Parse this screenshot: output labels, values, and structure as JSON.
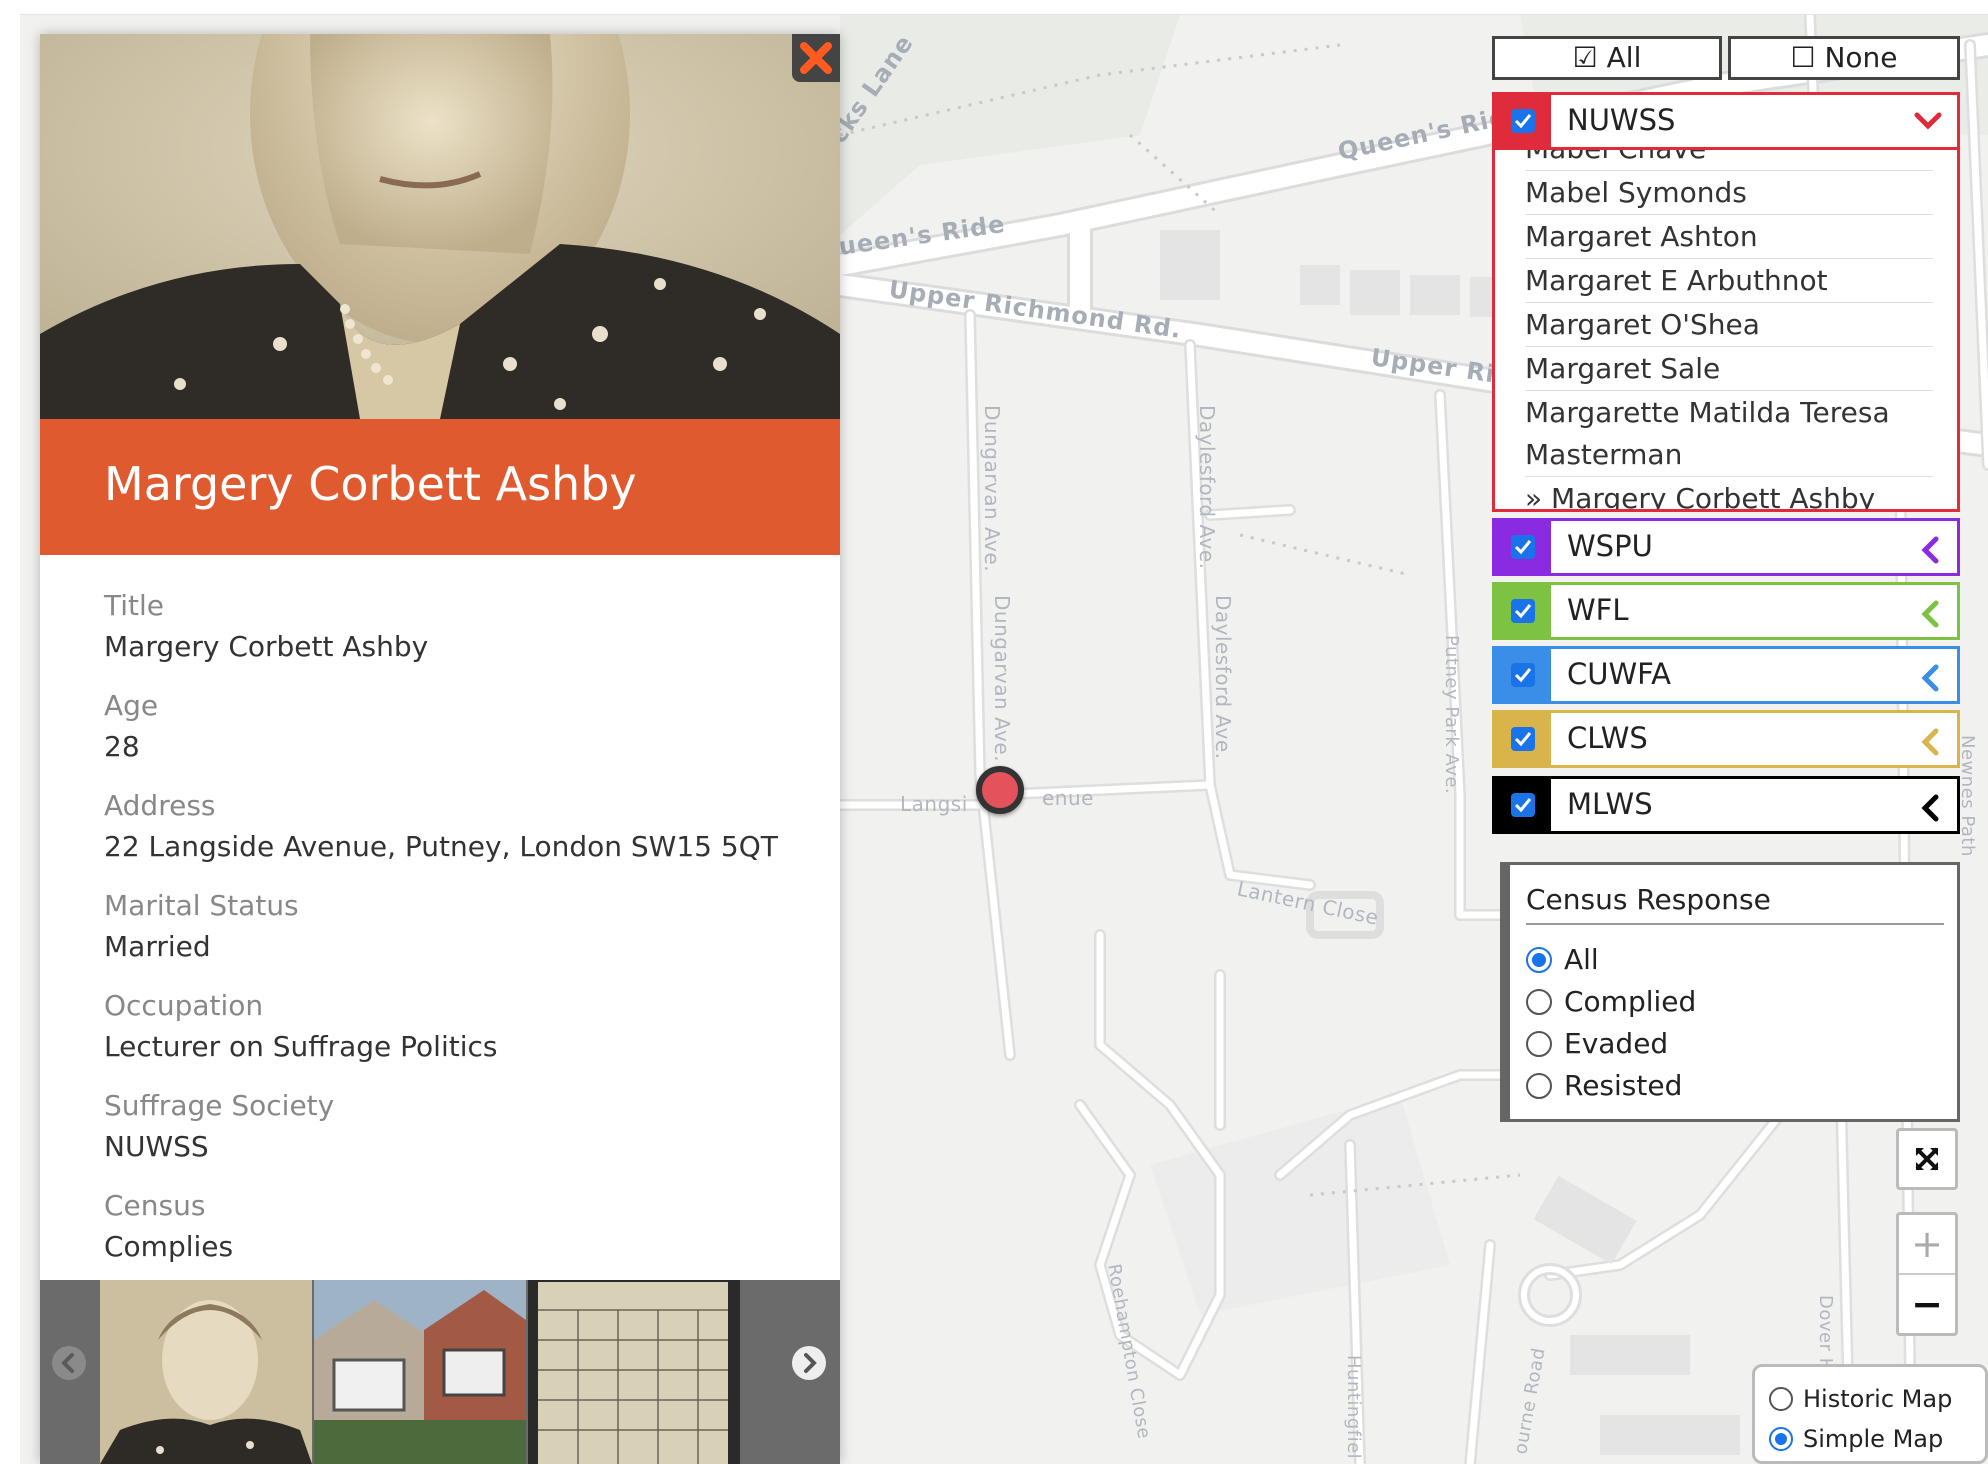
{
  "map": {
    "road_labels": {
      "queens_ride_right": "Queen's Ride",
      "queens_ride_left": "ueen's Ride",
      "upper_richmond": "Upper Richmond Rd.",
      "upper_richmond_right": "Upper Rich",
      "dungarvan_1": "Dungarvan Ave.",
      "dungarvan_2": "Dungarvan Ave.",
      "daylesford_1": "Daylesford Ave.",
      "daylesford_2": "Daylesford Ave.",
      "langside_left": "Langsi",
      "langside_right": "enue",
      "lantern_close": "Lantern Close",
      "putney_park": "Putney Park Ave.",
      "roehampton_close": "Roehampton Close",
      "huntingfield": "Huntingfiel",
      "dover": "Dover H",
      "bourne_road": "ourne Road",
      "lane": "cks Lane",
      "newnes": "Newnes Path"
    }
  },
  "popup": {
    "name": "Margery Corbett Ashby",
    "fields": [
      {
        "label": "Title",
        "value": "Margery Corbett Ashby"
      },
      {
        "label": "Age",
        "value": "28"
      },
      {
        "label": "Address",
        "value": "22 Langside Avenue, Putney, London SW15 5QT"
      },
      {
        "label": "Marital Status",
        "value": "Married"
      },
      {
        "label": "Occupation",
        "value": "Lecturer on Suffrage Politics"
      },
      {
        "label": "Suffrage Society",
        "value": "NUWSS"
      },
      {
        "label": "Census",
        "value": "Complies"
      }
    ]
  },
  "controls": {
    "all_label": "☑ All",
    "none_label": "☐ None",
    "societies": [
      {
        "name": "NUWSS",
        "color": "#e02c3a",
        "expanded": true
      },
      {
        "name": "WSPU",
        "color": "#8a2be2",
        "expanded": false
      },
      {
        "name": "WFL",
        "color": "#7dc242",
        "expanded": false
      },
      {
        "name": "CUWFA",
        "color": "#3b8ee8",
        "expanded": false
      },
      {
        "name": "CLWS",
        "color": "#d9b44a",
        "expanded": false
      },
      {
        "name": "MLWS",
        "color": "#000000",
        "expanded": false
      }
    ],
    "nuwss_members": [
      "Mabel Chave",
      "Mabel Symonds",
      "Margaret Ashton",
      "Margaret E Arbuthnot",
      "Margaret O'Shea",
      "Margaret Sale",
      "Margarette Matilda Teresa",
      "Masterman",
      "» Margery Corbett Ashby"
    ],
    "census": {
      "title": "Census Response",
      "options": [
        {
          "label": "All",
          "selected": true
        },
        {
          "label": "Complied",
          "selected": false
        },
        {
          "label": "Evaded",
          "selected": false
        },
        {
          "label": "Resisted",
          "selected": false
        }
      ]
    },
    "zoom_in": "+",
    "zoom_out": "−",
    "basemap": [
      {
        "label": "Historic Map",
        "selected": false
      },
      {
        "label": "Simple Map",
        "selected": true
      }
    ]
  }
}
